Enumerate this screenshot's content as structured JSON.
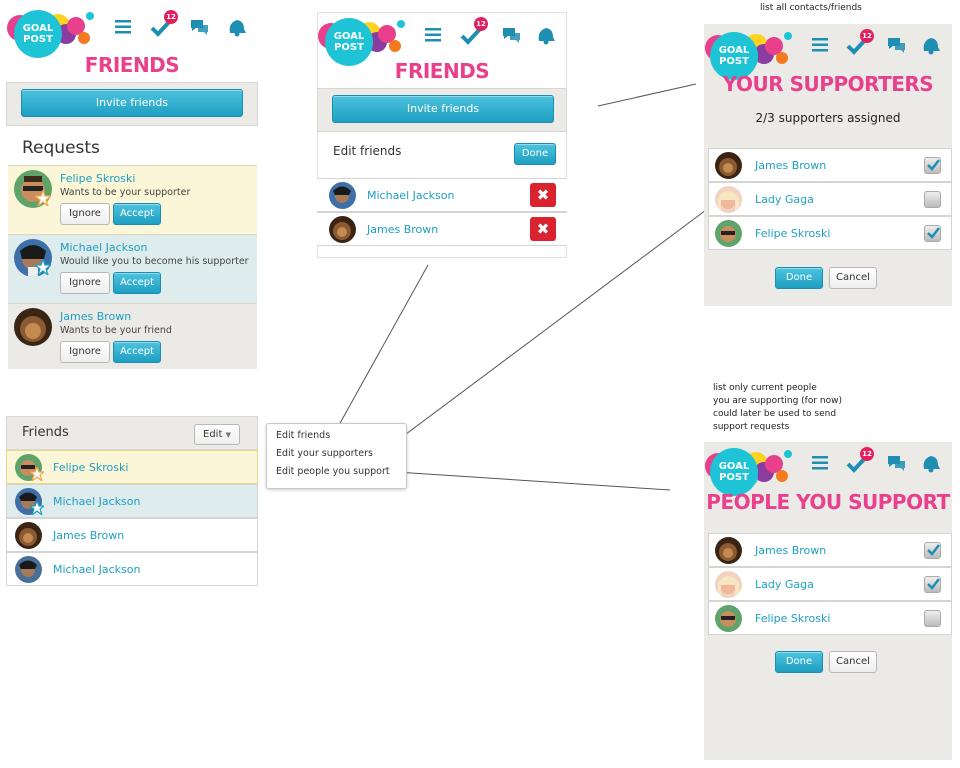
{
  "brand": {
    "logo_text_line1": "GOAL",
    "logo_text_line2": "POST",
    "badge_count": "12",
    "colors": {
      "accent": "#1ec3d6",
      "pink": "#e8408c",
      "button_blue": "#1e9fc2",
      "badge": "#e2205e",
      "remove": "#d9232f"
    }
  },
  "nav_icons": [
    "list-icon",
    "checkmark-icon",
    "chat-icon",
    "bell-icon"
  ],
  "screen_requests": {
    "title": "FRIENDS",
    "invite_label": "Invite friends",
    "requests_heading": "Requests",
    "requests": [
      {
        "name": "Felipe Skroski",
        "message": "Wants to be your supporter",
        "ignore": "Ignore",
        "accept": "Accept"
      },
      {
        "name": "Michael Jackson",
        "message": "Would like you to become his supporter",
        "ignore": "Ignore",
        "accept": "Accept"
      },
      {
        "name": "James Brown",
        "message": "Wants to be your friend",
        "ignore": "Ignore",
        "accept": "Accept"
      }
    ],
    "friends_heading": "Friends",
    "edit_label": "Edit",
    "friends": [
      {
        "name": "Felipe Skroski"
      },
      {
        "name": "Michael Jackson"
      },
      {
        "name": "James Brown"
      },
      {
        "name": "Michael Jackson"
      }
    ]
  },
  "edit_menu": {
    "items": [
      "Edit friends",
      "Edit your supporters",
      "Edit people you support"
    ]
  },
  "screen_edit_friends": {
    "title": "FRIENDS",
    "invite_label": "Invite friends",
    "edit_heading": "Edit friends",
    "done_label": "Done",
    "remove_glyph": "✖",
    "friends": [
      {
        "name": "Michael Jackson"
      },
      {
        "name": "James Brown"
      }
    ]
  },
  "screen_supporters": {
    "note": "list all contacts/friends",
    "title": "YOUR SUPPORTERS",
    "subtitle": "2/3 supporters  assigned",
    "contacts": [
      {
        "name": "James Brown",
        "checked": true
      },
      {
        "name": "Lady Gaga",
        "checked": false
      },
      {
        "name": "Felipe Skroski",
        "checked": true
      }
    ],
    "done_label": "Done",
    "cancel_label": "Cancel"
  },
  "screen_support": {
    "note_lines": [
      "list only current people",
      "you are supporting (for now)",
      "could later be used to send",
      "support requests"
    ],
    "title": "PEOPLE YOU SUPPORT",
    "contacts": [
      {
        "name": "James Brown",
        "checked": true
      },
      {
        "name": "Lady Gaga",
        "checked": true
      },
      {
        "name": "Felipe Skroski",
        "checked": false
      }
    ],
    "done_label": "Done",
    "cancel_label": "Cancel"
  }
}
